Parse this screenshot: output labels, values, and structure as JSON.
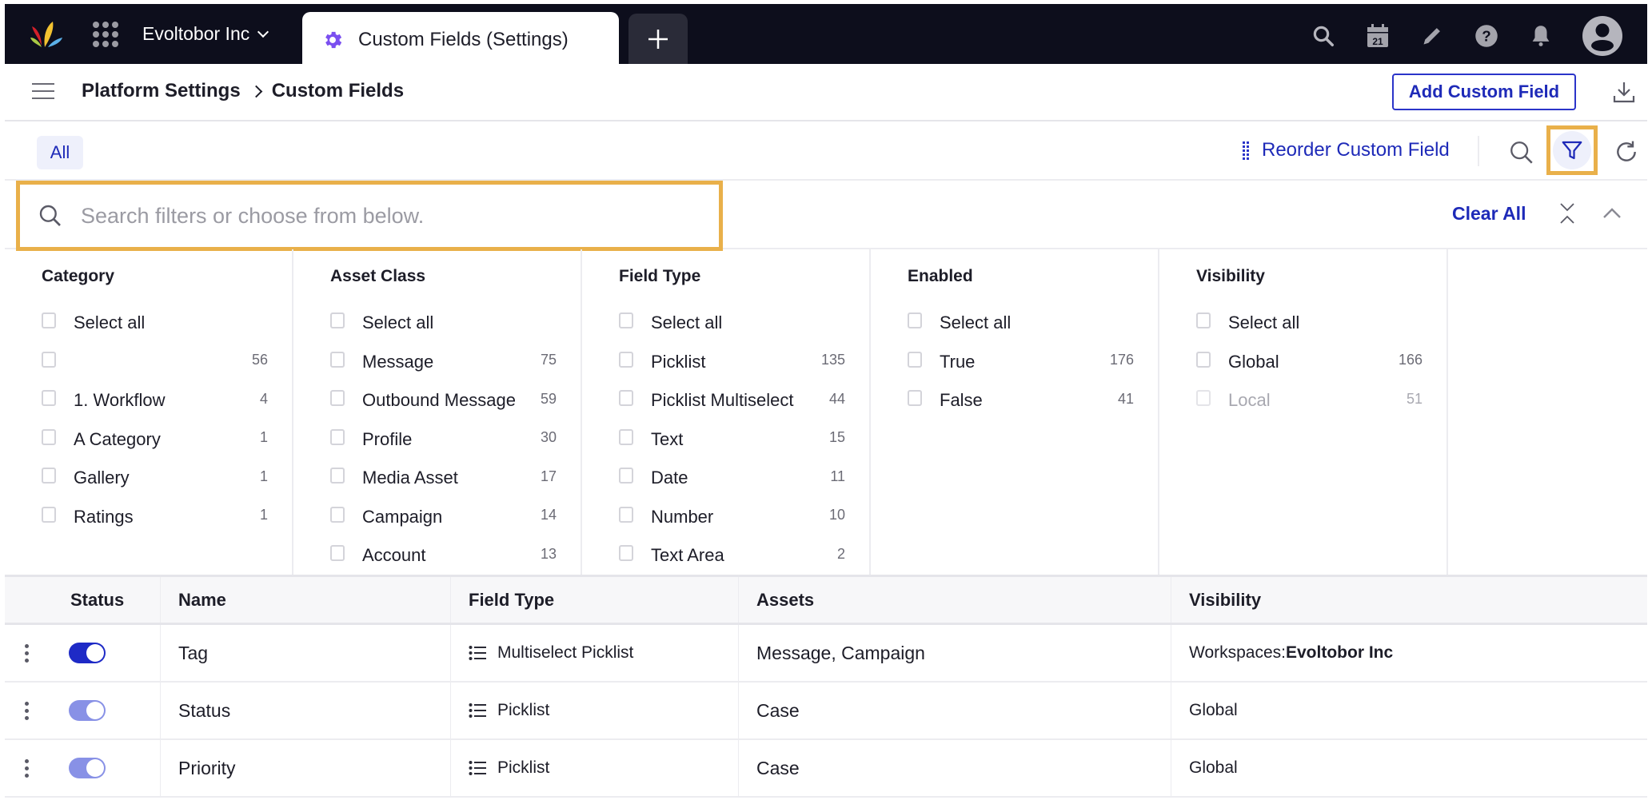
{
  "topbar": {
    "workspace_name": "Evoltobor Inc",
    "active_tab_label": "Custom Fields (Settings)",
    "icons": [
      "search-icon",
      "calendar-icon",
      "pencil-icon",
      "help-icon",
      "bell-icon",
      "avatar-icon"
    ],
    "calendar_day": "21"
  },
  "breadcrumb": {
    "parent": "Platform Settings",
    "current": "Custom Fields"
  },
  "header_actions": {
    "add_button_label": "Add Custom Field"
  },
  "toolbar": {
    "all_tab_label": "All",
    "reorder_label": "Reorder Custom Field"
  },
  "filter_search": {
    "placeholder": "Search filters or choose from below.",
    "value": "",
    "clear_all_label": "Clear All"
  },
  "filter_columns": [
    {
      "title": "Category",
      "items": [
        {
          "label": "Select all",
          "count": ""
        },
        {
          "label": "",
          "count": "56"
        },
        {
          "label": "1. Workflow",
          "count": "4"
        },
        {
          "label": "A Category",
          "count": "1"
        },
        {
          "label": "Gallery",
          "count": "1"
        },
        {
          "label": "Ratings",
          "count": "1"
        }
      ]
    },
    {
      "title": "Asset Class",
      "items": [
        {
          "label": "Select all",
          "count": ""
        },
        {
          "label": "Message",
          "count": "75"
        },
        {
          "label": "Outbound Message",
          "count": "59"
        },
        {
          "label": "Profile",
          "count": "30"
        },
        {
          "label": "Media Asset",
          "count": "17"
        },
        {
          "label": "Campaign",
          "count": "14"
        },
        {
          "label": "Account",
          "count": "13"
        }
      ]
    },
    {
      "title": "Field Type",
      "items": [
        {
          "label": "Select all",
          "count": ""
        },
        {
          "label": "Picklist",
          "count": "135"
        },
        {
          "label": "Picklist Multiselect",
          "count": "44"
        },
        {
          "label": "Text",
          "count": "15"
        },
        {
          "label": "Date",
          "count": "11"
        },
        {
          "label": "Number",
          "count": "10"
        },
        {
          "label": "Text Area",
          "count": "2"
        }
      ]
    },
    {
      "title": "Enabled",
      "items": [
        {
          "label": "Select all",
          "count": ""
        },
        {
          "label": "True",
          "count": "176"
        },
        {
          "label": "False",
          "count": "41"
        }
      ]
    },
    {
      "title": "Visibility",
      "items": [
        {
          "label": "Select all",
          "count": ""
        },
        {
          "label": "Global",
          "count": "166"
        },
        {
          "label": "Local",
          "count": "51",
          "disabled": true
        }
      ]
    }
  ],
  "table": {
    "headers": {
      "status": "Status",
      "name": "Name",
      "field_type": "Field Type",
      "assets": "Assets",
      "visibility": "Visibility"
    },
    "rows": [
      {
        "enabled": true,
        "toggle_color": "#1e2ac6",
        "name": "Tag",
        "field_type": "Multiselect Picklist",
        "assets": "Message, Campaign",
        "visibility_prefix": "Workspaces: ",
        "visibility_bold": "Evoltobor Inc"
      },
      {
        "enabled": true,
        "toggle_color": "#8891e6",
        "name": "Status",
        "field_type": "Picklist",
        "assets": "Case",
        "visibility_prefix": "Global",
        "visibility_bold": ""
      },
      {
        "enabled": true,
        "toggle_color": "#8891e6",
        "name": "Priority",
        "field_type": "Picklist",
        "assets": "Case",
        "visibility_prefix": "Global",
        "visibility_bold": ""
      }
    ]
  },
  "colors": {
    "topbar_bg": "#0d0e1c",
    "accent": "#1e2ab8",
    "highlight_outline": "#e9b04a",
    "tab_icon": "#7b4ff0"
  }
}
